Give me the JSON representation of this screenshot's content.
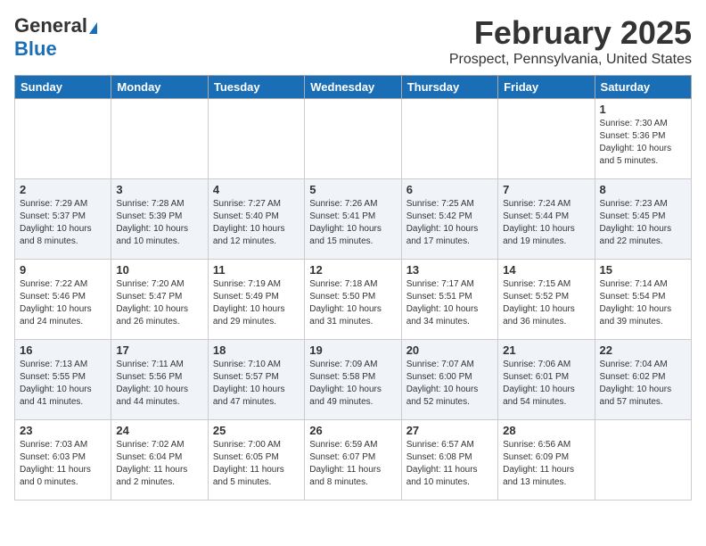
{
  "header": {
    "logo_general": "General",
    "logo_blue": "Blue",
    "month_title": "February 2025",
    "location": "Prospect, Pennsylvania, United States"
  },
  "weekdays": [
    "Sunday",
    "Monday",
    "Tuesday",
    "Wednesday",
    "Thursday",
    "Friday",
    "Saturday"
  ],
  "weeks": [
    [
      {
        "day": "",
        "info": ""
      },
      {
        "day": "",
        "info": ""
      },
      {
        "day": "",
        "info": ""
      },
      {
        "day": "",
        "info": ""
      },
      {
        "day": "",
        "info": ""
      },
      {
        "day": "",
        "info": ""
      },
      {
        "day": "1",
        "info": "Sunrise: 7:30 AM\nSunset: 5:36 PM\nDaylight: 10 hours and 5 minutes."
      }
    ],
    [
      {
        "day": "2",
        "info": "Sunrise: 7:29 AM\nSunset: 5:37 PM\nDaylight: 10 hours and 8 minutes."
      },
      {
        "day": "3",
        "info": "Sunrise: 7:28 AM\nSunset: 5:39 PM\nDaylight: 10 hours and 10 minutes."
      },
      {
        "day": "4",
        "info": "Sunrise: 7:27 AM\nSunset: 5:40 PM\nDaylight: 10 hours and 12 minutes."
      },
      {
        "day": "5",
        "info": "Sunrise: 7:26 AM\nSunset: 5:41 PM\nDaylight: 10 hours and 15 minutes."
      },
      {
        "day": "6",
        "info": "Sunrise: 7:25 AM\nSunset: 5:42 PM\nDaylight: 10 hours and 17 minutes."
      },
      {
        "day": "7",
        "info": "Sunrise: 7:24 AM\nSunset: 5:44 PM\nDaylight: 10 hours and 19 minutes."
      },
      {
        "day": "8",
        "info": "Sunrise: 7:23 AM\nSunset: 5:45 PM\nDaylight: 10 hours and 22 minutes."
      }
    ],
    [
      {
        "day": "9",
        "info": "Sunrise: 7:22 AM\nSunset: 5:46 PM\nDaylight: 10 hours and 24 minutes."
      },
      {
        "day": "10",
        "info": "Sunrise: 7:20 AM\nSunset: 5:47 PM\nDaylight: 10 hours and 26 minutes."
      },
      {
        "day": "11",
        "info": "Sunrise: 7:19 AM\nSunset: 5:49 PM\nDaylight: 10 hours and 29 minutes."
      },
      {
        "day": "12",
        "info": "Sunrise: 7:18 AM\nSunset: 5:50 PM\nDaylight: 10 hours and 31 minutes."
      },
      {
        "day": "13",
        "info": "Sunrise: 7:17 AM\nSunset: 5:51 PM\nDaylight: 10 hours and 34 minutes."
      },
      {
        "day": "14",
        "info": "Sunrise: 7:15 AM\nSunset: 5:52 PM\nDaylight: 10 hours and 36 minutes."
      },
      {
        "day": "15",
        "info": "Sunrise: 7:14 AM\nSunset: 5:54 PM\nDaylight: 10 hours and 39 minutes."
      }
    ],
    [
      {
        "day": "16",
        "info": "Sunrise: 7:13 AM\nSunset: 5:55 PM\nDaylight: 10 hours and 41 minutes."
      },
      {
        "day": "17",
        "info": "Sunrise: 7:11 AM\nSunset: 5:56 PM\nDaylight: 10 hours and 44 minutes."
      },
      {
        "day": "18",
        "info": "Sunrise: 7:10 AM\nSunset: 5:57 PM\nDaylight: 10 hours and 47 minutes."
      },
      {
        "day": "19",
        "info": "Sunrise: 7:09 AM\nSunset: 5:58 PM\nDaylight: 10 hours and 49 minutes."
      },
      {
        "day": "20",
        "info": "Sunrise: 7:07 AM\nSunset: 6:00 PM\nDaylight: 10 hours and 52 minutes."
      },
      {
        "day": "21",
        "info": "Sunrise: 7:06 AM\nSunset: 6:01 PM\nDaylight: 10 hours and 54 minutes."
      },
      {
        "day": "22",
        "info": "Sunrise: 7:04 AM\nSunset: 6:02 PM\nDaylight: 10 hours and 57 minutes."
      }
    ],
    [
      {
        "day": "23",
        "info": "Sunrise: 7:03 AM\nSunset: 6:03 PM\nDaylight: 11 hours and 0 minutes."
      },
      {
        "day": "24",
        "info": "Sunrise: 7:02 AM\nSunset: 6:04 PM\nDaylight: 11 hours and 2 minutes."
      },
      {
        "day": "25",
        "info": "Sunrise: 7:00 AM\nSunset: 6:05 PM\nDaylight: 11 hours and 5 minutes."
      },
      {
        "day": "26",
        "info": "Sunrise: 6:59 AM\nSunset: 6:07 PM\nDaylight: 11 hours and 8 minutes."
      },
      {
        "day": "27",
        "info": "Sunrise: 6:57 AM\nSunset: 6:08 PM\nDaylight: 11 hours and 10 minutes."
      },
      {
        "day": "28",
        "info": "Sunrise: 6:56 AM\nSunset: 6:09 PM\nDaylight: 11 hours and 13 minutes."
      },
      {
        "day": "",
        "info": ""
      }
    ]
  ]
}
